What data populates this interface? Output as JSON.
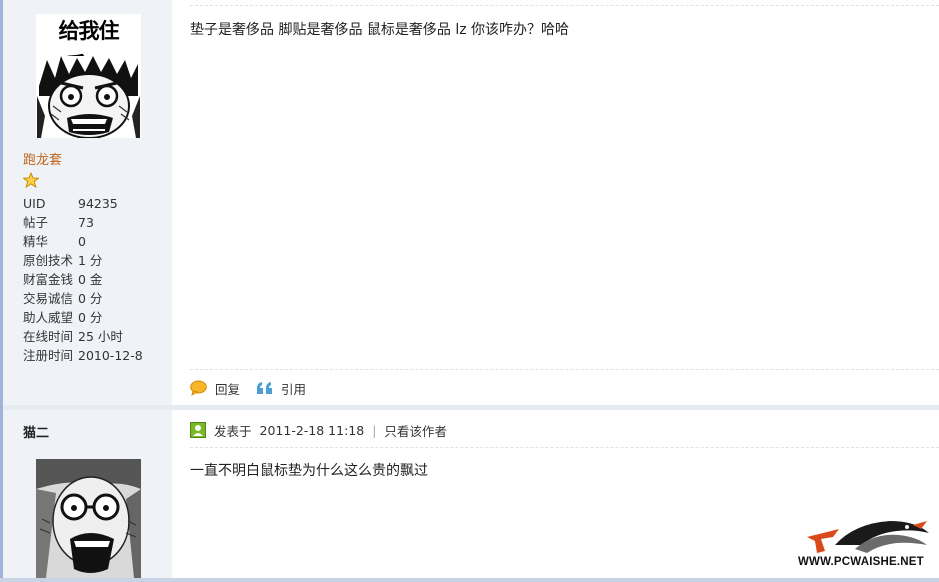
{
  "post1": {
    "author": {
      "avatar_caption": "给我住手!!!",
      "username": "跑龙套",
      "rank_icon": "star-icon",
      "profile": [
        {
          "key": "UID",
          "value": "94235"
        },
        {
          "key": "帖子",
          "value": "73"
        },
        {
          "key": "精华",
          "value": "0"
        },
        {
          "key": "原创技术",
          "value": "1 分"
        },
        {
          "key": "财富金钱",
          "value": "0 金"
        },
        {
          "key": "交易诚信",
          "value": "0 分"
        },
        {
          "key": "助人威望",
          "value": "0 分"
        },
        {
          "key": "在线时间",
          "value": "25 小时"
        },
        {
          "key": "注册时间",
          "value": "2010-12-8"
        }
      ]
    },
    "text": "垫子是奢侈品  脚贴是奢侈品  鼠标是奢侈品  lz 你该咋办？哈哈",
    "actions": {
      "reply_label": "回复",
      "quote_label": "引用"
    }
  },
  "post2": {
    "author": {
      "username": "猫二"
    },
    "meta": {
      "posted_label": "发表于",
      "timestamp": "2011-2-18 11:18",
      "separator": "|",
      "only_author_label": "只看该作者"
    },
    "text": "一直不明白鼠标垫为什么这么贵的飘过"
  },
  "watermark": {
    "text": "WWW.PCWAISHE.NET"
  },
  "colors": {
    "author_bg": "#eff3f8",
    "username_orange": "#c0651b",
    "border_blue": "#9fb4d6",
    "icon_green": "#7ab828",
    "icon_orange": "#f3a81b",
    "icon_quote_blue": "#4a9fd6"
  }
}
